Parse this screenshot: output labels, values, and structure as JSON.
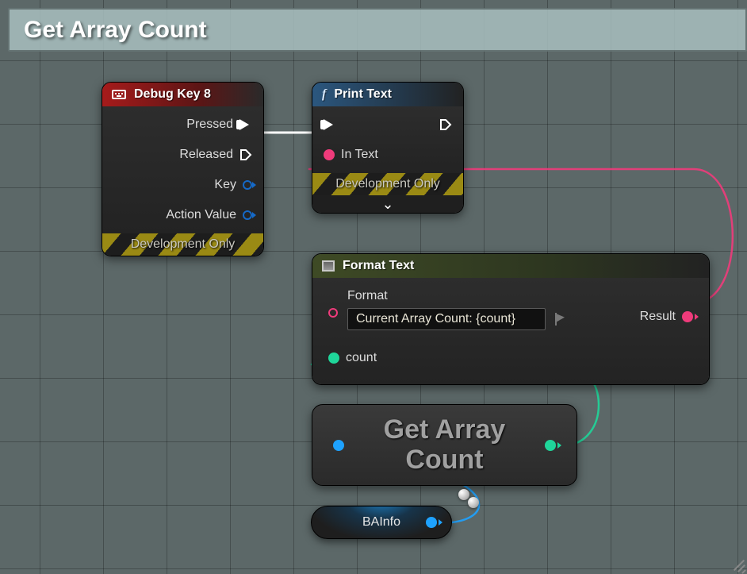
{
  "title": "Get Array Count",
  "nodes": {
    "debug_key": {
      "title": "Debug Key 8",
      "pins": {
        "pressed": "Pressed",
        "released": "Released",
        "key": "Key",
        "action_value": "Action Value"
      },
      "dev_only": "Development Only"
    },
    "print_text": {
      "title": "Print Text",
      "pins": {
        "in_text": "In Text"
      },
      "dev_only": "Development Only"
    },
    "format_text": {
      "title": "Format Text",
      "pins": {
        "format": "Format",
        "count": "count",
        "result": "Result"
      },
      "format_value": "Current Array Count: {count}"
    },
    "get_array_count": {
      "title": "Get Array Count"
    },
    "bainfo": {
      "title": "BAInfo"
    }
  },
  "colors": {
    "exec": "#ffffff",
    "text_pin": "#ef3b7b",
    "wildcard_green": "#1fd69a",
    "object_blue": "#1ea2ff"
  }
}
